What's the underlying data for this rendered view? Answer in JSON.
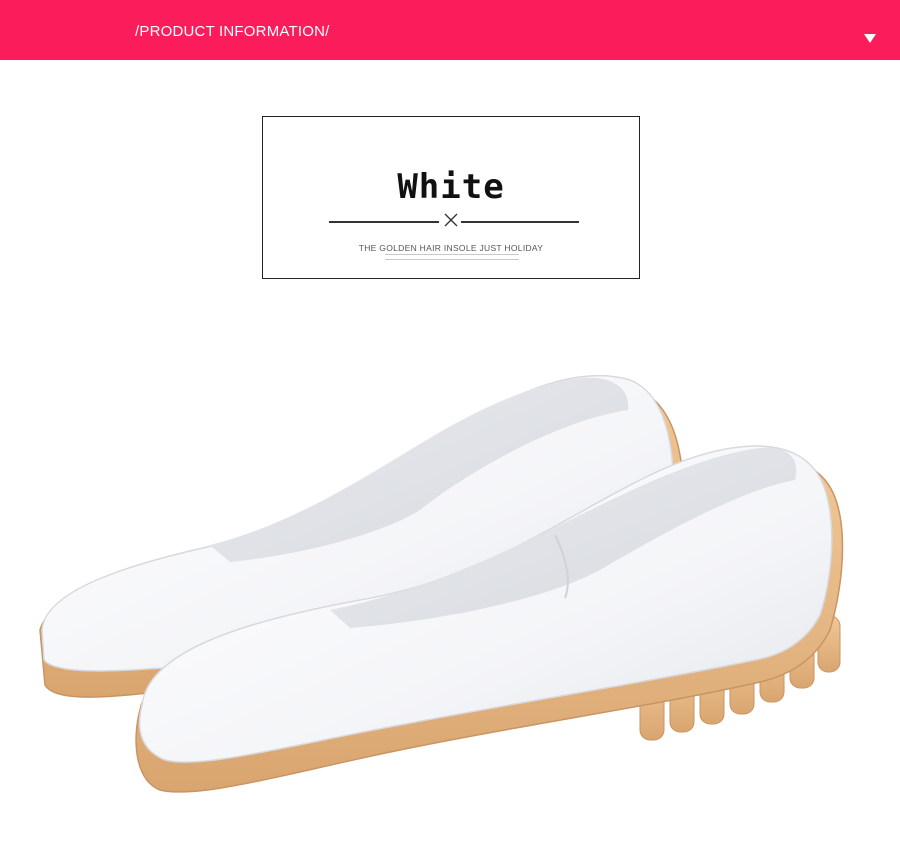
{
  "header": {
    "title": "/PRODUCT INFORMATION/",
    "background_color": "#fb1c5b",
    "toggle_icon": "triangle-down-icon"
  },
  "label_card": {
    "color_name": "White",
    "tagline": "THE GOLDEN HAIR INSOLE JUST HOLIDAY",
    "divider_icon": "x-icon"
  },
  "product": {
    "image": "white-leather-flat-shoes-photo",
    "upper_color": "#f7f8fa",
    "sole_color": "#e6b582"
  }
}
